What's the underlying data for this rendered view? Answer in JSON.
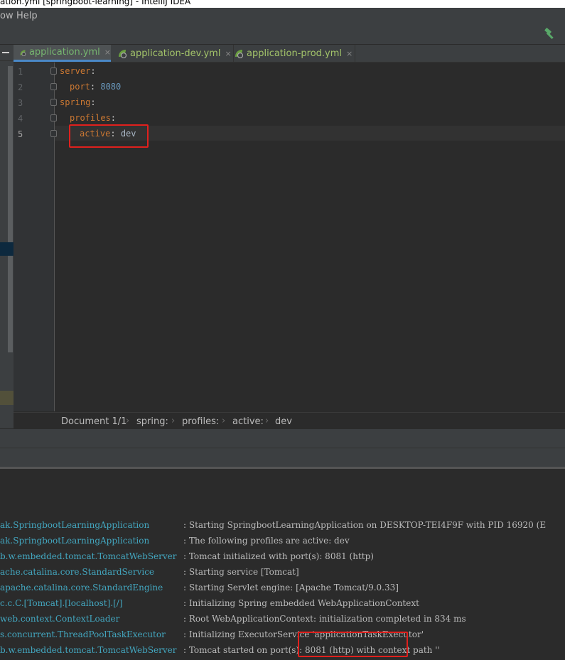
{
  "window": {
    "title": "ation.yml [springboot-learning] - IntelliJ IDEA"
  },
  "menu": {
    "items": [
      "ow",
      "Help"
    ]
  },
  "toolbar": {
    "build_icon": "hammer-icon"
  },
  "tabs": [
    {
      "label": "application.yml",
      "active": true,
      "close": "×"
    },
    {
      "label": "application-dev.yml",
      "active": false,
      "close": "×"
    },
    {
      "label": "application-prod.yml",
      "active": false,
      "close": "×"
    }
  ],
  "editor": {
    "line_numbers": [
      "1",
      "2",
      "3",
      "4",
      "5"
    ],
    "lines": [
      {
        "key": "server",
        "colon": ":",
        "value": ""
      },
      {
        "key": "port",
        "colon": ": ",
        "value": "8080"
      },
      {
        "key": "spring",
        "colon": ":",
        "value": ""
      },
      {
        "key": "profiles",
        "colon": ":",
        "value": ""
      },
      {
        "key": "active",
        "colon": ": ",
        "value": "dev"
      }
    ]
  },
  "breadcrumb": {
    "items": [
      "Document 1/1",
      "spring:",
      "profiles:",
      "active:",
      "dev"
    ],
    "separator": "›"
  },
  "console": {
    "lines": [
      {
        "logger": "ak.SpringbootLearningApplication",
        "message": ": Starting SpringbootLearningApplication on DESKTOP-TEI4F9F with PID 16920 (E"
      },
      {
        "logger": "ak.SpringbootLearningApplication",
        "message": ": The following profiles are active: dev"
      },
      {
        "logger": "b.w.embedded.tomcat.TomcatWebServer",
        "message": ": Tomcat initialized with port(s): 8081 (http)"
      },
      {
        "logger": "ache.catalina.core.StandardService",
        "message": ": Starting service [Tomcat]"
      },
      {
        "logger": "apache.catalina.core.StandardEngine",
        "message": ": Starting Servlet engine: [Apache Tomcat/9.0.33]"
      },
      {
        "logger": "c.c.C.[Tomcat].[localhost].[/]",
        "message": ": Initializing Spring embedded WebApplicationContext"
      },
      {
        "logger": "web.context.ContextLoader",
        "message": ": Root WebApplicationContext: initialization completed in 834 ms"
      },
      {
        "logger": "s.concurrent.ThreadPoolTaskExecutor",
        "message": ": Initializing ExecutorService 'applicationTaskExecutor'"
      },
      {
        "logger": "b.w.embedded.tomcat.TomcatWebServer",
        "message": ": Tomcat started on port(s): 8081 (http) with context path ''"
      }
    ]
  },
  "colors": {
    "highlight_box": "#e0201d",
    "accent": "#4a88c7",
    "logger": "#43a7c0",
    "yaml_key": "#cc7832",
    "number": "#6897bb"
  }
}
